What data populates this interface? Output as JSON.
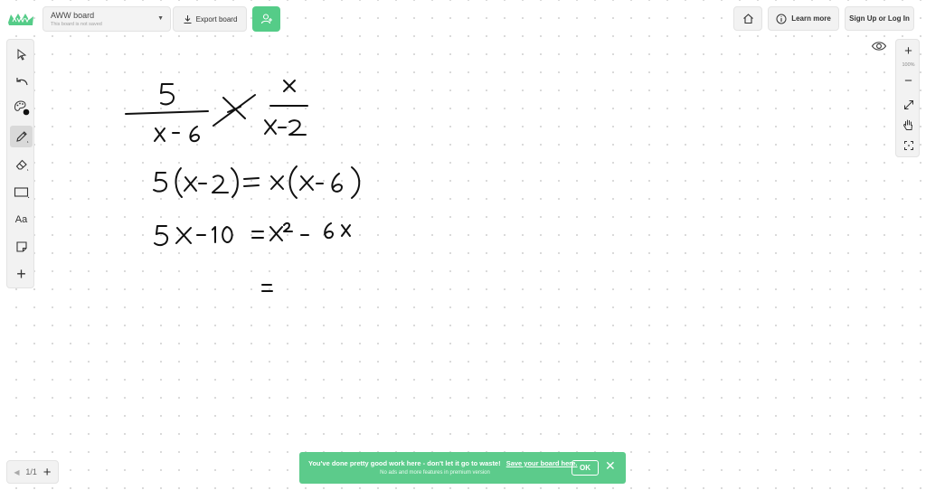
{
  "header": {
    "board_title": "AWW board",
    "board_subtitle": "This board is not saved",
    "export_label": "Export board",
    "learn_more_label": "Learn more",
    "signup_label": "Sign Up or Log In"
  },
  "left_toolbar": {
    "text_tool_label": "Aa",
    "tools": [
      "select-icon",
      "undo-icon",
      "palette-icon",
      "pencil-icon",
      "eraser-icon",
      "rectangle-icon",
      "text-tool",
      "sticky-note-icon",
      "add-icon"
    ],
    "active_tool": "pencil-icon"
  },
  "right_toolbar": {
    "zoom_in_label": "+",
    "zoom_level": "100%",
    "zoom_out_label": "−",
    "tools": [
      "zoom-in",
      "zoom-out",
      "fit-screen-icon",
      "hand-icon",
      "focus-icon"
    ]
  },
  "pager": {
    "prev_label": "◀",
    "page_indicator": "1/1",
    "add_label": "+"
  },
  "toast": {
    "message": "You've done pretty good work here - don't let it go to waste!",
    "link": "Save your board here.",
    "sub": "No ads and more features in premium version",
    "ok_label": "OK",
    "close_label": "✕"
  },
  "colors": {
    "accent_green": "#5ccb8b",
    "invite_green": "#55cc88",
    "ink": "#111111"
  }
}
